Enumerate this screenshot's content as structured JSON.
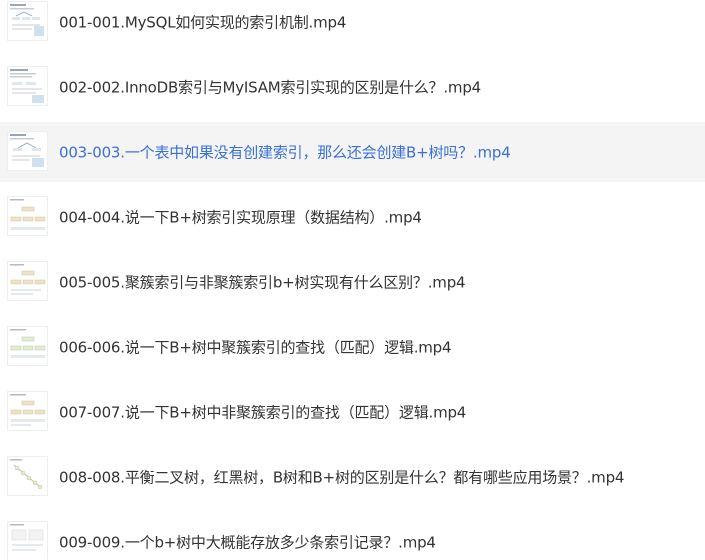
{
  "files": [
    {
      "name": "001-001.MySQL如何实现的索引机制.mp4",
      "thumbnail": "slide-thumbnail",
      "selected": false
    },
    {
      "name": "002-002.InnoDB索引与MyISAM索引实现的区别是什么？.mp4",
      "thumbnail": "slide-thumbnail",
      "selected": false
    },
    {
      "name": "003-003.一个表中如果没有创建索引，那么还会创建B+树吗？.mp4",
      "thumbnail": "slide-thumbnail",
      "selected": true
    },
    {
      "name": "004-004.说一下B+树索引实现原理（数据结构）.mp4",
      "thumbnail": "tree-thumbnail",
      "selected": false
    },
    {
      "name": "005-005.聚簇索引与非聚簇索引b+树实现有什么区别？.mp4",
      "thumbnail": "tree-thumbnail",
      "selected": false
    },
    {
      "name": "006-006.说一下B+树中聚簇索引的查找（匹配）逻辑.mp4",
      "thumbnail": "tree-thumbnail",
      "selected": false
    },
    {
      "name": "007-007.说一下B+树中非聚簇索引的查找（匹配）逻辑.mp4",
      "thumbnail": "tree-thumbnail",
      "selected": false
    },
    {
      "name": "008-008.平衡二叉树，红黑树，B树和B+树的区别是什么？都有哪些应用场景？.mp4",
      "thumbnail": "diagonal-thumbnail",
      "selected": false
    },
    {
      "name": "009-009.一个b+树中大概能存放多少条索引记录？.mp4",
      "thumbnail": "table-thumbnail",
      "selected": false
    }
  ],
  "colors": {
    "text": "#333333",
    "selected_text": "#3a6fd8",
    "selected_background": "#f4f4f4"
  }
}
